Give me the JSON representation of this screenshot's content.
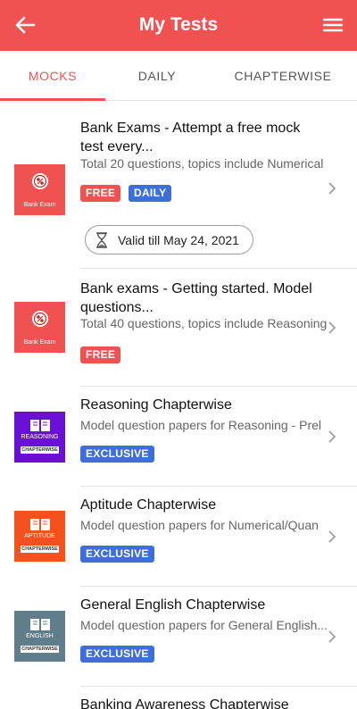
{
  "appbar": {
    "title": "My Tests",
    "color": "#f05252"
  },
  "tabs": [
    {
      "label": "MOCKS",
      "active": true
    },
    {
      "label": "DAILY",
      "active": false
    },
    {
      "label": "CHAPTERWISE",
      "active": false
    }
  ],
  "items": [
    {
      "title": "Bank Exams - Attempt a free mock test every...",
      "subtitle": "Total 20 questions, topics include Numerical",
      "thumb_label": "Bank Exam",
      "badges": [
        "FREE",
        "DAILY"
      ],
      "validity": "Valid till May 24, 2021"
    },
    {
      "title": "Bank exams - Getting started. Model questions...",
      "subtitle": "Total 40 questions, topics include Reasoning",
      "thumb_label": "Bank Exam",
      "badges": [
        "FREE"
      ]
    },
    {
      "title": "Reasoning Chapterwise",
      "subtitle": "Model question papers for Reasoning - Prel",
      "thumb_label": "REASONING",
      "thumb_tag": "CHAPTERWISE",
      "badges": [
        "EXCLUSIVE"
      ]
    },
    {
      "title": "Aptitude Chapterwise",
      "subtitle": "Model question papers for Numerical/Quan",
      "thumb_label": "APTITUDE",
      "thumb_tag": "CHAPTERWISE",
      "badges": [
        "EXCLUSIVE"
      ]
    },
    {
      "title": "General English Chapterwise",
      "subtitle": "Model question papers for General English...",
      "thumb_label": "ENGLISH",
      "thumb_tag": "CHAPTERWISE",
      "badges": [
        "EXCLUSIVE"
      ]
    },
    {
      "title": "Banking Awareness Chapterwise"
    }
  ],
  "colors": {
    "accent": "#f05252",
    "badge_blue": "#3d6fdb",
    "reasoning": "#6a0fd6",
    "aptitude": "#f4511e",
    "english": "#607d8b"
  },
  "icons": {
    "back": "arrow-left-icon",
    "menu": "hamburger-menu-icon",
    "chevron": "chevron-right-icon",
    "validity": "hourglass-icon",
    "bank_exam": "percent-circle-icon",
    "chapterwise": "open-book-icon"
  }
}
